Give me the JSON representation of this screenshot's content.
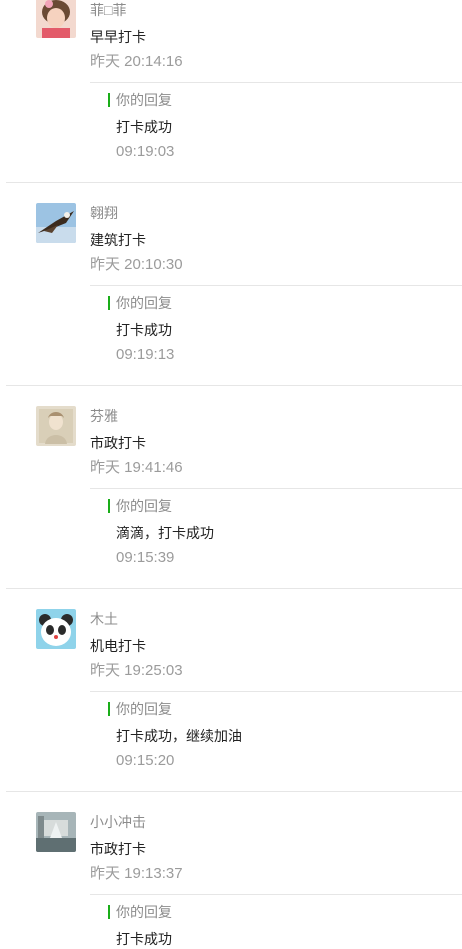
{
  "comments": [
    {
      "name": "菲□菲",
      "message": "早早打卡",
      "time": "昨天 20:14:16",
      "avatar_icon": "girl-portrait-avatar",
      "reply": {
        "label": "你的回复",
        "text": "打卡成功",
        "time": "09:19:03"
      }
    },
    {
      "name": "翱翔",
      "message": "建筑打卡",
      "time": "昨天 20:10:30",
      "avatar_icon": "eagle-avatar",
      "reply": {
        "label": "你的回复",
        "text": "打卡成功",
        "time": "09:19:13"
      }
    },
    {
      "name": "芬雅",
      "message": "市政打卡",
      "time": "昨天 19:41:46",
      "avatar_icon": "portrait-painting-avatar",
      "reply": {
        "label": "你的回复",
        "text": "滴滴，打卡成功",
        "time": "09:15:39"
      }
    },
    {
      "name": "木土",
      "message": "机电打卡",
      "time": "昨天 19:25:03",
      "avatar_icon": "panda-avatar",
      "reply": {
        "label": "你的回复",
        "text": "打卡成功，继续加油",
        "time": "09:15:20"
      }
    },
    {
      "name": "小小冲击",
      "message": "市政打卡",
      "time": "昨天 19:13:37",
      "avatar_icon": "fountain-avatar",
      "reply": {
        "label": "你的回复",
        "text": "打卡成功",
        "time": ""
      }
    }
  ],
  "colors": {
    "accent": "#1aad19",
    "separator": "#e6e6e6",
    "meta_text": "#9b9b9b"
  }
}
